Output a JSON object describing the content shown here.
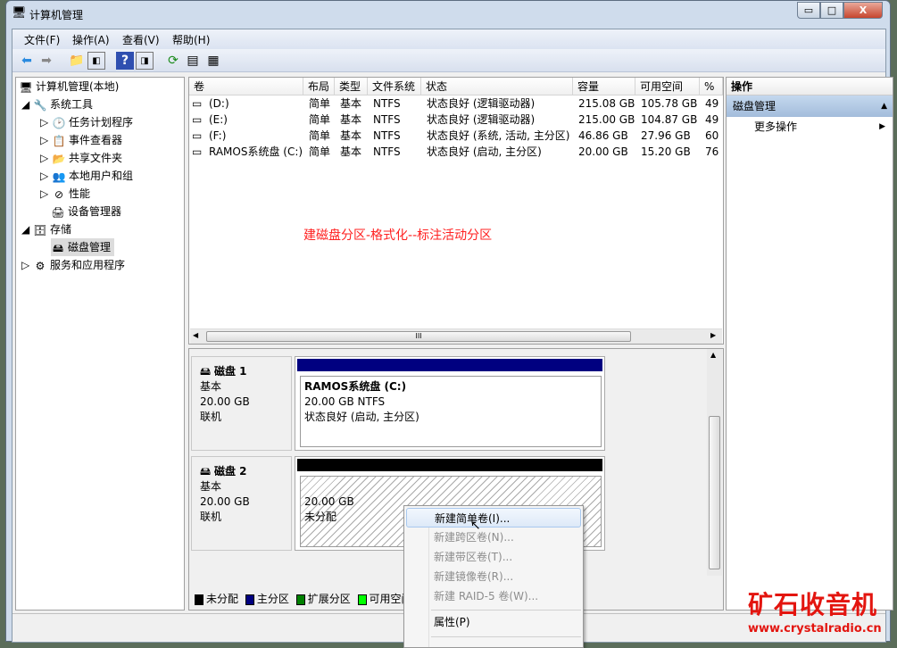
{
  "window": {
    "title": "计算机管理",
    "minimize": "▭",
    "maximize": "□",
    "close": "X"
  },
  "menu": [
    "文件(F)",
    "操作(A)",
    "查看(V)",
    "帮助(H)"
  ],
  "tree": {
    "root": "计算机管理(本地)",
    "items": [
      {
        "label": "系统工具",
        "level": 1
      },
      {
        "label": "任务计划程序",
        "level": 2
      },
      {
        "label": "事件查看器",
        "level": 2
      },
      {
        "label": "共享文件夹",
        "level": 2
      },
      {
        "label": "本地用户和组",
        "level": 2
      },
      {
        "label": "性能",
        "level": 2
      },
      {
        "label": "设备管理器",
        "level": 2
      },
      {
        "label": "存储",
        "level": 1
      },
      {
        "label": "磁盘管理",
        "level": 2,
        "selected": true
      },
      {
        "label": "服务和应用程序",
        "level": 1
      }
    ]
  },
  "volumes": {
    "columns": [
      "卷",
      "布局",
      "类型",
      "文件系统",
      "状态",
      "容量",
      "可用空间",
      "%"
    ],
    "rows": [
      [
        "(D:)",
        "简单",
        "基本",
        "NTFS",
        "状态良好 (逻辑驱动器)",
        "215.08 GB",
        "105.78 GB",
        "49"
      ],
      [
        "(E:)",
        "简单",
        "基本",
        "NTFS",
        "状态良好 (逻辑驱动器)",
        "215.00 GB",
        "104.87 GB",
        "49"
      ],
      [
        "(F:)",
        "简单",
        "基本",
        "NTFS",
        "状态良好 (系统, 活动, 主分区)",
        "46.86 GB",
        "27.96 GB",
        "60"
      ],
      [
        "RAMOS系统盘 (C:)",
        "简单",
        "基本",
        "NTFS",
        "状态良好 (启动, 主分区)",
        "20.00 GB",
        "15.20 GB",
        "76"
      ]
    ],
    "scroll_grip": "III"
  },
  "annotation": "建磁盘分区-格式化--标注活动分区",
  "disks": [
    {
      "name": "磁盘 1",
      "type": "基本",
      "size": "20.00 GB",
      "state": "联机",
      "bar_color": "#000080",
      "part_title": "RAMOS系统盘  (C:)",
      "part_line1": "20.00 GB NTFS",
      "part_line2": "状态良好 (启动, 主分区)"
    },
    {
      "name": "磁盘 2",
      "type": "基本",
      "size": "20.00 GB",
      "state": "联机",
      "bar_color": "#000000",
      "part_title": "",
      "part_line1": "20.00 GB",
      "part_line2": "未分配"
    }
  ],
  "legend": [
    {
      "label": "未分配",
      "color": "#000000"
    },
    {
      "label": "主分区",
      "color": "#000080"
    },
    {
      "label": "扩展分区",
      "color": "#008000"
    },
    {
      "label": "可用空间",
      "color": "#00ff00"
    }
  ],
  "actions": {
    "header": "操作",
    "section": "磁盘管理",
    "more": "更多操作"
  },
  "context_menu": [
    {
      "label": "新建简单卷(I)...",
      "enabled": true,
      "hover": true
    },
    {
      "label": "新建跨区卷(N)...",
      "enabled": false
    },
    {
      "label": "新建带区卷(T)...",
      "enabled": false
    },
    {
      "label": "新建镜像卷(R)...",
      "enabled": false
    },
    {
      "label": "新建 RAID-5 卷(W)...",
      "enabled": false
    },
    {
      "label": "属性(P)",
      "enabled": true
    }
  ],
  "watermark": {
    "name": "矿石收音机",
    "url": "www.crystalradio.cn"
  }
}
